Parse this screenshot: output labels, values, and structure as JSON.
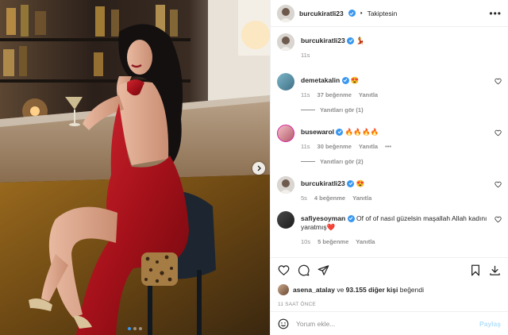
{
  "header": {
    "username": "burcukiratli23",
    "separator": "•",
    "follow_status": "Takiptesin"
  },
  "caption": {
    "username": "burcukiratli23",
    "text": "💃",
    "time": "11s"
  },
  "comments": [
    {
      "username": "demetakalin",
      "text": "😍",
      "time": "11s",
      "likes": "37 beğenme",
      "reply": "Yanıtla",
      "view_replies": "Yanıtları gör (1)"
    },
    {
      "username": "busewarol",
      "text": "🔥🔥🔥🔥",
      "time": "11s",
      "likes": "30 beğenme",
      "reply": "Yanıtla",
      "more": "•••",
      "view_replies": "Yanıtları gör (2)"
    },
    {
      "username": "burcukiratli23",
      "text": "😍",
      "time": "5s",
      "likes": "4 beğenme",
      "reply": "Yanıtla"
    },
    {
      "username": "safiyesoyman",
      "text": "Of of of nasıl güzelsin maşallah Allah kadını yaratmış❤️",
      "time": "10s",
      "likes": "5 beğenme",
      "reply": "Yanıtla"
    }
  ],
  "likes": {
    "user": "asena_atalay",
    "connector": "ve",
    "count": "93.155 diğer kişi",
    "suffix": "beğendi"
  },
  "time_ago": "11 SAAT ÖNCE",
  "add_comment": {
    "placeholder": "Yorum ekle...",
    "post_label": "Paylaş"
  },
  "carousel": {
    "total": 3,
    "current": 1
  },
  "colors": {
    "verified": "#3897f0",
    "dress": "#b3141c",
    "post_disabled": "#b2dffc"
  }
}
